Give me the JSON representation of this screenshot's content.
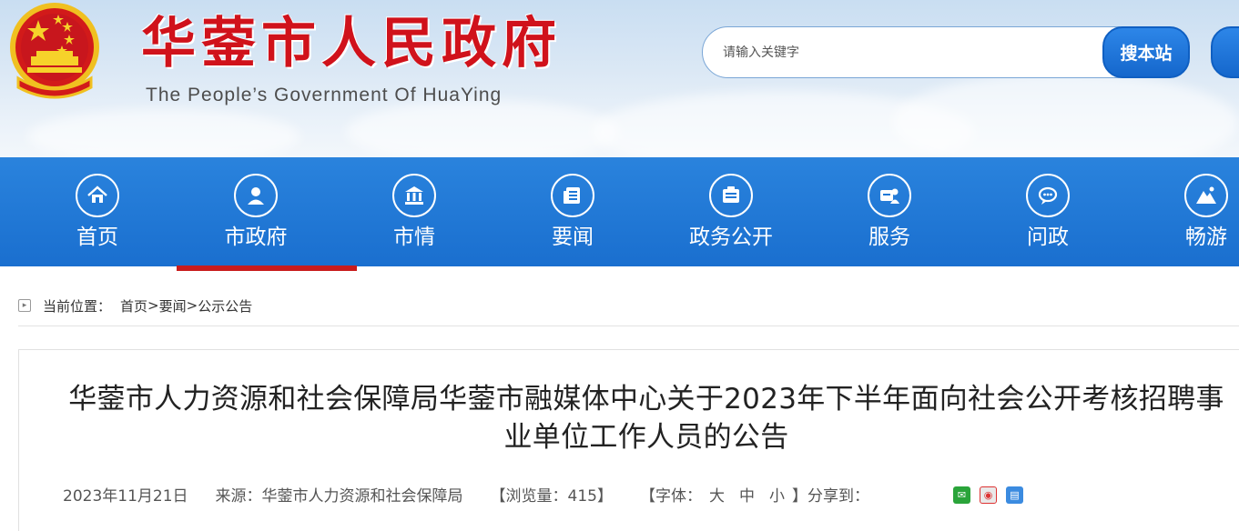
{
  "header": {
    "title": "华蓥市人民政府",
    "subtitle": "The People’s Government Of HuaYing",
    "search_placeholder": "请输入关键字",
    "search_button": "搜本站"
  },
  "nav": {
    "items": [
      {
        "label": "首页",
        "icon": "home-icon"
      },
      {
        "label": "市政府",
        "icon": "person-icon"
      },
      {
        "label": "市情",
        "icon": "building-icon"
      },
      {
        "label": "要闻",
        "icon": "news-icon"
      },
      {
        "label": "政务公开",
        "icon": "document-icon"
      },
      {
        "label": "服务",
        "icon": "service-icon"
      },
      {
        "label": "问政",
        "icon": "chat-icon"
      },
      {
        "label": "畅游",
        "icon": "mountain-icon"
      }
    ],
    "active_index": 1,
    "active_color": "#c91c1c",
    "bar_color": "#1f77d6"
  },
  "breadcrumb": {
    "label": "当前位置：",
    "items": [
      "首页",
      "要闻",
      "公示公告"
    ],
    "separator": ">"
  },
  "article": {
    "title": "华蓥市人力资源和社会保障局华蓥市融媒体中心关于2023年下半年面向社会公开考核招聘事业单位工作人员的公告",
    "date": "2023年11月21日",
    "source": "来源：华蓥市人力资源和社会保障局",
    "views": "【浏览量：415】",
    "font_size_prefix": "【字体：",
    "font_large": "大",
    "font_medium": "中",
    "font_small": "小",
    "font_size_suffix": "】",
    "share_label": "分享到："
  },
  "share": [
    {
      "name": "wechat-icon",
      "glyph": "✉"
    },
    {
      "name": "weibo-icon",
      "glyph": "◉"
    },
    {
      "name": "qzone-icon",
      "glyph": "▤"
    }
  ]
}
